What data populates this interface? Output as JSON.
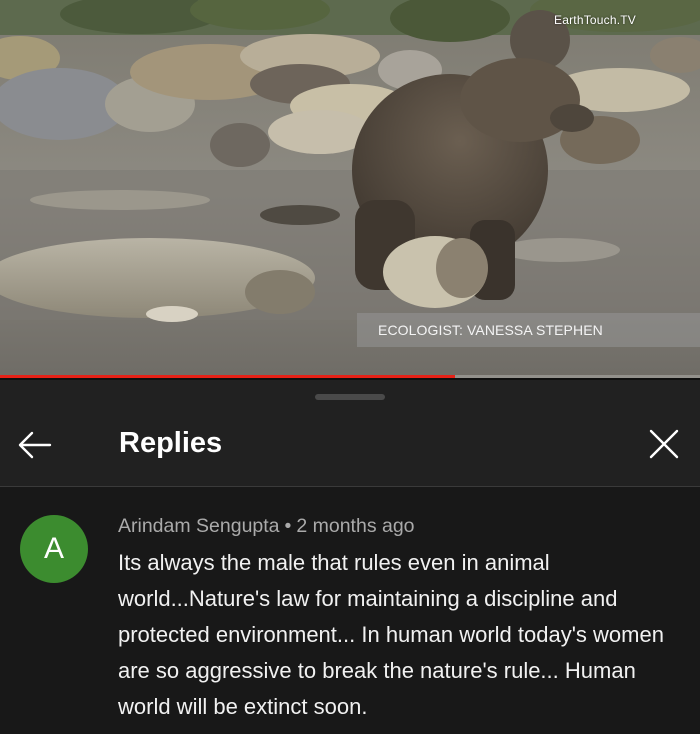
{
  "video": {
    "watermark": "EarthTouch.TV",
    "caption": "ECOLOGIST: VANESSA STEPHEN",
    "progress_fraction": 0.65
  },
  "panel": {
    "title": "Replies",
    "back_icon": "arrow-left-icon",
    "close_icon": "close-icon"
  },
  "comment": {
    "avatar_letter": "A",
    "avatar_color": "#3c8c2f",
    "author": "Arindam Sengupta",
    "separator": "•",
    "time": "2 months ago",
    "text": "Its always the male that rules even in animal world...Nature's law for maintaining a discipline and protected environment... In human world today's women are so aggressive to break the nature's rule... Human world will be extinct soon."
  }
}
